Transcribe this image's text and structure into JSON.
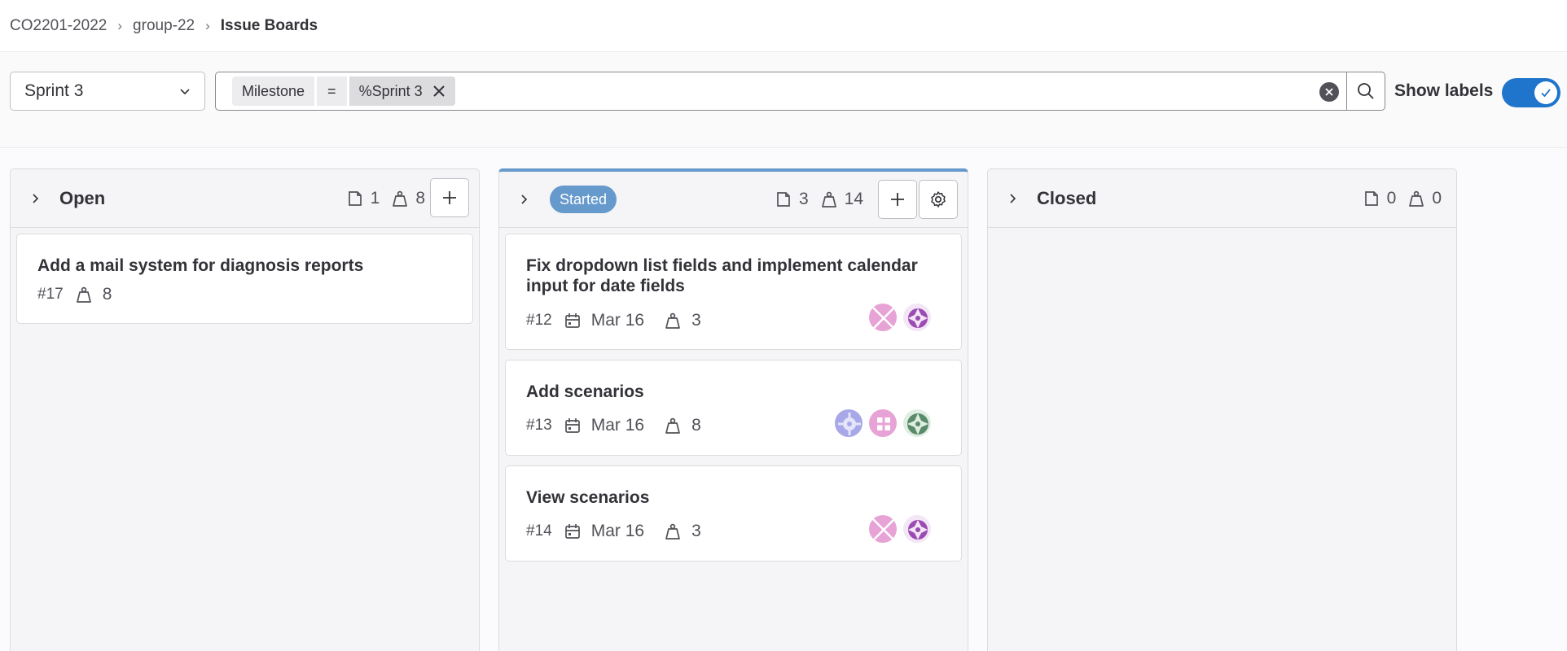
{
  "breadcrumb": {
    "items": [
      "CO2201-2022",
      "group-22"
    ],
    "current": "Issue Boards"
  },
  "filter": {
    "milestone_select": "Sprint 3",
    "token": {
      "field": "Milestone",
      "operator": "=",
      "value": "%Sprint 3"
    },
    "show_labels_label": "Show labels",
    "show_labels_on": true
  },
  "lists": [
    {
      "title": "Open",
      "issue_count": "1",
      "weight": "8",
      "cards": [
        {
          "title": "Add a mail system for diagnosis reports",
          "ref": "#17",
          "weight": "8"
        }
      ]
    },
    {
      "title": "Started",
      "label_color": "#6699cc",
      "issue_count": "3",
      "weight": "14",
      "cards": [
        {
          "title": "Fix dropdown list fields and implement calendar input for date fields",
          "ref": "#12",
          "due": "Mar 16",
          "weight": "3"
        },
        {
          "title": "Add scenarios",
          "ref": "#13",
          "due": "Mar 16",
          "weight": "8"
        },
        {
          "title": "View scenarios",
          "ref": "#14",
          "due": "Mar 16",
          "weight": "3"
        }
      ]
    },
    {
      "title": "Closed",
      "issue_count": "0",
      "weight": "0",
      "cards": []
    }
  ],
  "colors": {
    "accent": "#1f75cb",
    "started_label": "#6699cc",
    "avatar_pink": "#e7a3d6",
    "avatar_purple": "#9b4bb3",
    "avatar_lavender": "#a8a8e8",
    "avatar_green": "#5a8a68"
  }
}
